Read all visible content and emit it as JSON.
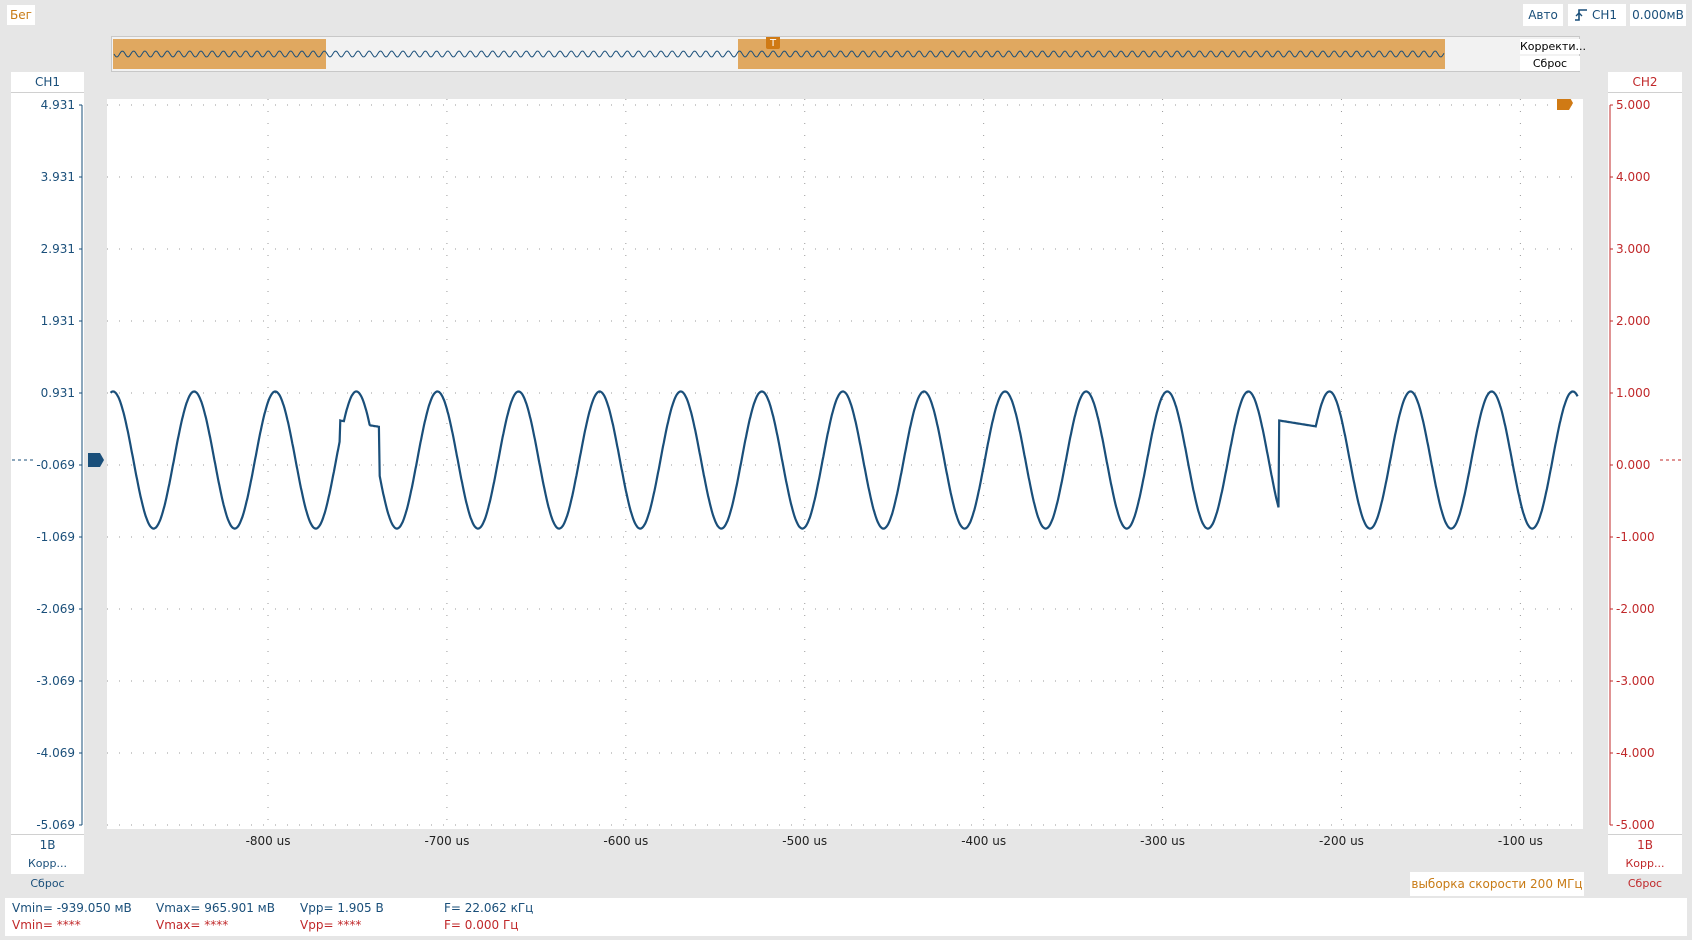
{
  "status": {
    "run_state": "Бег"
  },
  "trigger": {
    "mode": "Авто",
    "channel": "CH1",
    "level": "0.000мВ",
    "marker": "T"
  },
  "overview": {
    "correct_label": "Корректи...",
    "reset_label": "Сброс"
  },
  "ch1": {
    "name": "CH1",
    "scale": "1В",
    "correct": "Корр...",
    "reset": "Сброс",
    "ticks": [
      "4.931",
      "3.931",
      "2.931",
      "1.931",
      "0.931",
      "-0.069",
      "-1.069",
      "-2.069",
      "-3.069",
      "-4.069",
      "-5.069"
    ],
    "color": "#1a4f7a"
  },
  "ch2": {
    "name": "CH2",
    "scale": "1В",
    "correct": "Корр...",
    "reset": "Сброс",
    "ticks": [
      "5.000",
      "4.000",
      "3.000",
      "2.000",
      "1.000",
      "0.000",
      "-1.000",
      "-2.000",
      "-3.000",
      "-4.000",
      "-5.000"
    ],
    "color": "#c0282a"
  },
  "xaxis": {
    "ticks": [
      "-800 us",
      "-700 us",
      "-600 us",
      "-500 us",
      "-400 us",
      "-300 us",
      "-200 us",
      "-100 us"
    ]
  },
  "sample_rate": "выборка скорости 200 МГц",
  "measurements": {
    "ch1": {
      "vmin": "Vmin= -939.050 мВ",
      "vmax": "Vmax= 965.901 мВ",
      "vpp": "Vpp= 1.905 В",
      "freq": "F= 22.062 кГц"
    },
    "ch2": {
      "vmin": "Vmin= ****",
      "vmax": "Vmax= ****",
      "vpp": "Vpp= ****",
      "freq": "F= 0.000 Гц"
    }
  },
  "chart_data": {
    "type": "line",
    "x_range_us": [
      -890,
      -65
    ],
    "ylim": [
      -5.069,
      4.931
    ],
    "signal": {
      "amplitude_v": 0.952,
      "offset_v": 0.0,
      "frequency_khz": 22.062
    },
    "glitches_us": [
      -760,
      -235
    ],
    "grid": true
  }
}
